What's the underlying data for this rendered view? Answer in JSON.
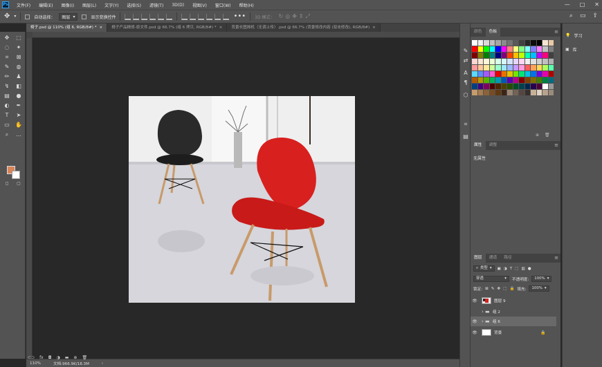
{
  "app": {
    "logo_text": "Ps"
  },
  "menu": [
    "文件(F)",
    "编辑(E)",
    "图像(I)",
    "图层(L)",
    "文字(Y)",
    "选择(S)",
    "滤镜(T)",
    "3D(D)",
    "视图(V)",
    "窗口(W)",
    "帮助(H)"
  ],
  "options_bar": {
    "auto_select_label": "自动选择：",
    "auto_select_value": "图层",
    "show_transform_label": "显示变换控件",
    "mode_3d_label": "3D 模式："
  },
  "tabs": [
    {
      "label": "椅子.psd @ 110% (组 6, RGB/8#) *",
      "active": true
    },
    {
      "label": "椅子产品精修-原文件.psd @ 66.7% (组 6 拷贝, RGB/8#) *",
      "active": false
    },
    {
      "label": "背景长图排机（无调上传）.psd @ 66.7% (背景修改内容 (双击修改), RGB/8#)",
      "active": false
    }
  ],
  "status": {
    "zoom": "110%",
    "doc": "文档:966.9K/18.3M"
  },
  "colors": {
    "foreground": "#d8855a",
    "background": "#ffffff",
    "chair_red": "#d8201e",
    "chair_black": "#2a2a2a"
  },
  "panels": {
    "swatches_tabs": [
      "颜色",
      "色板"
    ],
    "properties_tabs": [
      "属性",
      "调整"
    ],
    "properties_empty": "无属性",
    "layers_tabs": [
      "图层",
      "通道",
      "路径"
    ],
    "kind_label": "类型",
    "blend_mode": "穿透",
    "opacity_label": "不透明度:",
    "opacity_value": "100%",
    "lock_label": "锁定:",
    "fill_label": "填充:",
    "fill_value": "100%",
    "layers": [
      {
        "name": "图层 9",
        "type": "pixel",
        "visible": true,
        "selected": false
      },
      {
        "name": "组 2",
        "type": "group",
        "visible": false,
        "selected": false
      },
      {
        "name": "组 6",
        "type": "group",
        "visible": true,
        "selected": true
      },
      {
        "name": "背景",
        "type": "background",
        "visible": true,
        "selected": false
      }
    ]
  },
  "learn_panel": {
    "learn": "学习",
    "library": "库"
  },
  "swatch_rows": [
    [
      "#ffffff",
      "#f2f2f2",
      "#d9d9d9",
      "#bfbfbf",
      "#a6a6a6",
      "#8c8c8c",
      "#737373",
      "#595959",
      "#404040",
      "#262626",
      "#0d0d0d",
      "#000000",
      "#f5e6d3",
      "#e8c9a6"
    ],
    [
      "#ff0000",
      "#ffff00",
      "#00ff00",
      "#00ffff",
      "#0000ff",
      "#ff00ff",
      "#ff8080",
      "#ffff80",
      "#80ff80",
      "#80ffff",
      "#8080ff",
      "#ff80ff",
      "#c0c0c0",
      "#808080"
    ],
    [
      "#800000",
      "#808000",
      "#008000",
      "#008080",
      "#000080",
      "#800080",
      "#ff4000",
      "#ffbf00",
      "#bfff00",
      "#00ffbf",
      "#00bfff",
      "#bf00ff",
      "#ff0080",
      "#404040"
    ],
    [
      "#ffd5d5",
      "#ffe9d5",
      "#fff6d5",
      "#eaffd5",
      "#d5ffe9",
      "#d5f6ff",
      "#d5e3ff",
      "#e6d5ff",
      "#ffd5f3",
      "#f0f0f0",
      "#e0e0e0",
      "#d0d0d0",
      "#c0c0c0",
      "#b0b0b0"
    ],
    [
      "#ff9a9a",
      "#ffc69a",
      "#ffe89a",
      "#cdff9a",
      "#9affcd",
      "#9ae8ff",
      "#9ab9ff",
      "#c69aff",
      "#ff9ae1",
      "#ff5a5a",
      "#ffa35a",
      "#ffd95a",
      "#b0ff5a",
      "#5affb0"
    ],
    [
      "#5ad9ff",
      "#5a8dff",
      "#a35aff",
      "#ff5ad0",
      "#e60000",
      "#e67300",
      "#e6c300",
      "#73e600",
      "#00e673",
      "#00c3e6",
      "#0073e6",
      "#7300e6",
      "#e600b0",
      "#b30000"
    ],
    [
      "#b35900",
      "#b39800",
      "#59b300",
      "#00b359",
      "#0098b3",
      "#0059b3",
      "#5900b3",
      "#b30089",
      "#800000",
      "#804000",
      "#806c00",
      "#408000",
      "#008040",
      "#006c80"
    ],
    [
      "#004080",
      "#400080",
      "#800062",
      "#4d0000",
      "#4d2600",
      "#4d4100",
      "#264d00",
      "#004d26",
      "#00414d",
      "#00264d",
      "#26004d",
      "#4d003b",
      "#ffffff",
      "#999999"
    ],
    [
      "#c69c6d",
      "#a67c52",
      "#8c6239",
      "#754c24",
      "#603913",
      "#3c2415",
      "#998675",
      "#736357",
      "#534741",
      "#362f2d",
      "#c7b299",
      "#e1d3c1",
      "#b7a390",
      "#9b8b7a"
    ]
  ]
}
